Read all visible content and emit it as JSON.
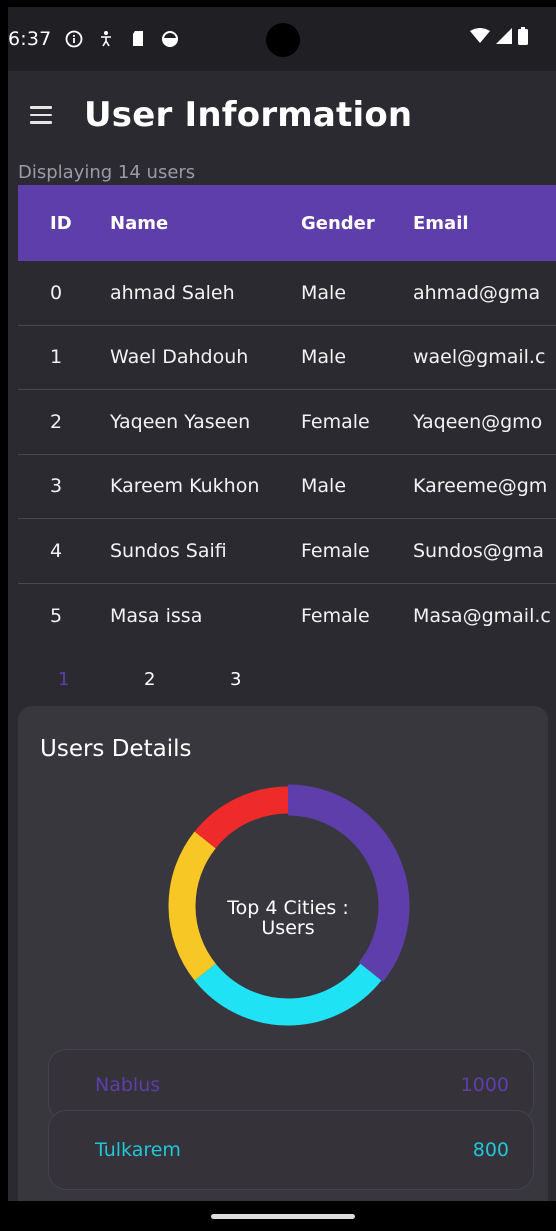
{
  "status_bar": {
    "time": "6:37",
    "left_icons": [
      "info-icon",
      "accessibility-icon",
      "sd-card-icon",
      "circle-status-icon"
    ],
    "right_icons": [
      "wifi-icon",
      "signal-icon",
      "battery-icon"
    ]
  },
  "app_bar": {
    "title": "User Information",
    "menu_icon": "menu-icon"
  },
  "subtitle": "Displaying 14 users",
  "table": {
    "headers": {
      "id": "ID",
      "name": "Name",
      "gender": "Gender",
      "email": "Email"
    },
    "rows": [
      {
        "id": "0",
        "name": "ahmad Saleh",
        "gender": "Male",
        "email": "ahmad@gma"
      },
      {
        "id": "1",
        "name": "Wael Dahdouh",
        "gender": "Male",
        "email": "wael@gmail.c"
      },
      {
        "id": "2",
        "name": "Yaqeen Yaseen",
        "gender": "Female",
        "email": "Yaqeen@gmo"
      },
      {
        "id": "3",
        "name": "Kareem Kukhon",
        "gender": "Male",
        "email": "Kareeme@gm"
      },
      {
        "id": "4",
        "name": "Sundos Saifi",
        "gender": "Female",
        "email": "Sundos@gma"
      },
      {
        "id": "5",
        "name": "Masa issa",
        "gender": "Female",
        "email": "Masa@gmail.c"
      }
    ],
    "header_color": "#5e3eaa"
  },
  "pager": {
    "pages": [
      "1",
      "2",
      "3"
    ],
    "current": "1"
  },
  "details": {
    "title": "Users Details",
    "center_label_line1": "Top 4 Cities :",
    "center_label_line2": "Users",
    "cities": [
      {
        "name": "Nablus",
        "value": "1000",
        "color": "#5e3eaa"
      },
      {
        "name": "Tulkarem",
        "value": "800",
        "color": "#1fc7d9"
      }
    ]
  },
  "chart_data": {
    "type": "pie",
    "title": "Top 4 Cities : Users",
    "series": [
      {
        "name": "Nablus",
        "value": 1000,
        "color": "#5e3eaa"
      },
      {
        "name": "Tulkarem",
        "value": 800,
        "color": "#1fe3f5"
      },
      {
        "name": "",
        "value": 600,
        "color": "#f7c825"
      },
      {
        "name": "",
        "value": 400,
        "color": "#ee2a2a"
      }
    ]
  }
}
